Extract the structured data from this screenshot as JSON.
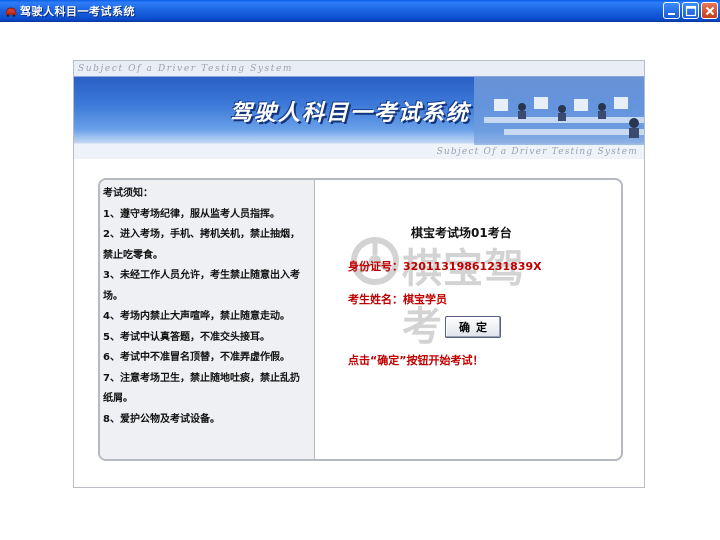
{
  "window": {
    "title": "驾驶人科目一考试系统",
    "icon": "car-icon"
  },
  "banner": {
    "subtitle_top": "Subject Of a Driver Testing System",
    "title": "驾驶人科目一考试系统",
    "subtitle_bottom": "Subject Of a Driver Testing System"
  },
  "notice": {
    "lines": [
      "考试须知：",
      "1、遵守考场纪律，服从监考人员指挥。",
      "2、进入考场，手机、拷机关机，禁止抽烟，",
      "禁止吃零食。",
      "3、未经工作人员允许，考生禁止随意出入考",
      "场。",
      "4、考场内禁止大声喧哗，禁止随意走动。",
      "5、考试中认真答题，不准交头接耳。",
      "6、考试中不准冒名顶替，不准弄虚作假。",
      "7、注意考场卫生，禁止随地吐痰，禁止乱扔",
      "纸屑。",
      "8、爱护公物及考试设备。"
    ]
  },
  "exam": {
    "venue": "棋宝考试场01考台",
    "id_label": "身份证号：",
    "id_value": "32011319861231839X",
    "name_label": "考生姓名：",
    "name_value": "棋宝学员",
    "confirm_label": "确定",
    "hint": "点击“确定”按钮开始考试！"
  },
  "watermark": {
    "text": "棋宝驾考"
  },
  "colors": {
    "titlebar": "#1a63e0",
    "banner_blue": "#3d7ad8",
    "label_red": "#c00000",
    "panel_border": "#b5b9c0"
  }
}
